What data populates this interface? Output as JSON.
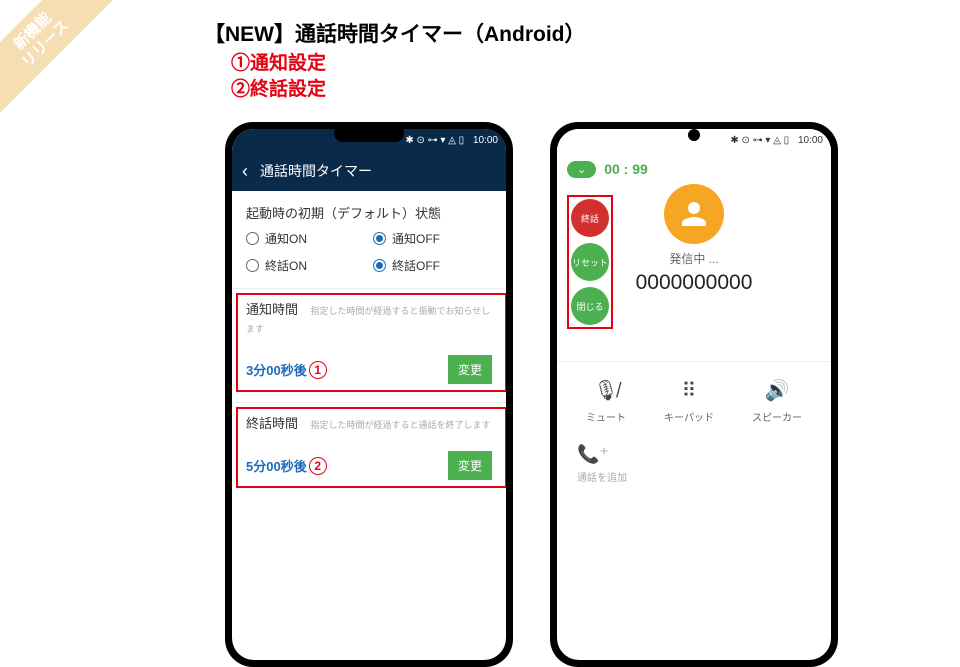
{
  "banner": {
    "line1": "新機能",
    "line2": "リリース"
  },
  "title": "【NEW】通話時間タイマー（Android）",
  "callouts": {
    "c1": "①通知設定",
    "c2": "②終話設定"
  },
  "statusbar": {
    "icons": "✱ ⊙ ⊶ ▾ ◬ ▯",
    "time": "10:00"
  },
  "screen1": {
    "title": "通話時間タイマー",
    "default_label": "起動時の初期（デフォルト）状態",
    "radios": {
      "notify_on": "通知ON",
      "notify_off": "通知OFF",
      "end_on": "終話ON",
      "end_off": "終話OFF"
    },
    "notify": {
      "label": "通知時間",
      "desc": "指定した時間が経過すると振動でお知らせします",
      "value": "3分00秒後",
      "num": "1",
      "btn": "変更"
    },
    "end": {
      "label": "終話時間",
      "desc": "指定した時間が経過すると通話を終了します",
      "value": "5分00秒後",
      "num": "2",
      "btn": "変更"
    }
  },
  "screen2": {
    "timer_pill": "⌄",
    "time": "00 : 99",
    "float": {
      "end": "終話",
      "reset": "リセット",
      "close": "閉じる"
    },
    "status": "発信中 ...",
    "number": "0000000000",
    "actions": {
      "mute": "ミュート",
      "keypad": "キーパッド",
      "speaker": "スピーカー"
    },
    "add_call": "通話を追加"
  }
}
